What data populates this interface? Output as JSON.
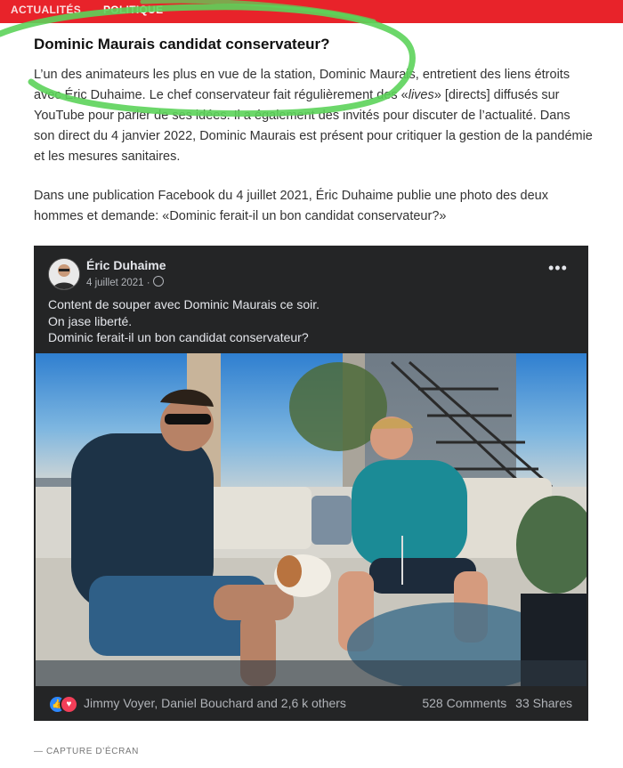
{
  "nav": {
    "item1": "ACTUALITÉS",
    "item2": "POLITIQUE"
  },
  "article": {
    "headline": "Dominic Maurais candidat conservateur?",
    "p1_part1": "L’un des animateurs les plus en vue de la station, Dominic Maurais, entretient des liens étroits avec Éric Duhaime. Le chef conservateur fait régulièrement des «",
    "p1_em": "lives",
    "p1_part2": "» [directs] diffusés sur YouTube pour parler de ses idées. Il a également des invités pour discuter de l’actualité. Dans son direct du 4 janvier 2022, Dominic Maurais est présent pour critiquer la gestion de la pandémie et les mesures sanitaires.",
    "p2": "Dans une publication Facebook du 4 juillet 2021, Éric Duhaime publie une photo des deux hommes et demande: «Dominic ferait-il un bon candidat conservateur?»"
  },
  "post": {
    "author": "Éric Duhaime",
    "date": "4 juillet 2021 ·",
    "line1": "Content de souper avec Dominic Maurais ce soir.",
    "line2": "On jase liberté.",
    "line3": "Dominic ferait-il un bon candidat conservateur?",
    "more": "•••",
    "reactions_names": "Jimmy Voyer, Daniel Bouchard and 2,6 k others",
    "comments": "528 Comments",
    "shares": "33 Shares"
  },
  "caption": "— CAPTURE D’ÉCRAN",
  "colors": {
    "topbar": "#e8232a",
    "scribble": "#5cd35a",
    "fb_bg": "#242526",
    "like": "#2d88ff",
    "love": "#f33e58"
  },
  "icons": {
    "globe": "globe-icon",
    "like": "like-reaction-icon",
    "love": "love-reaction-icon",
    "more": "more-options-icon"
  }
}
